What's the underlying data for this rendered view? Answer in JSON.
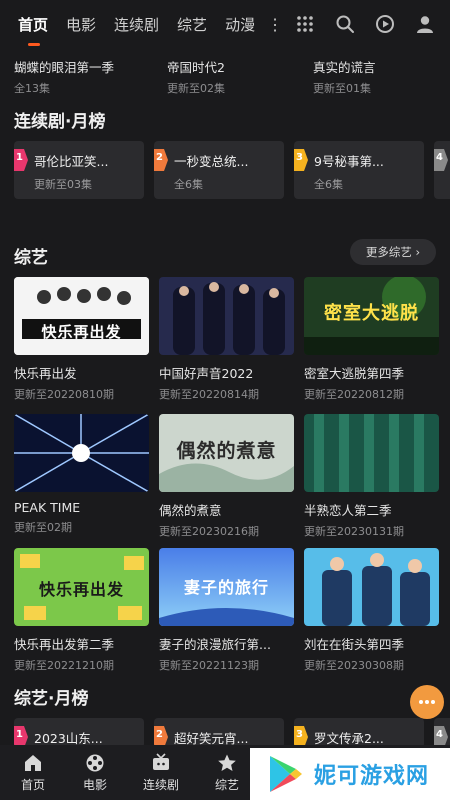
{
  "topnav": {
    "tabs": [
      {
        "label": "首页",
        "active": true
      },
      {
        "label": "电影",
        "active": false
      },
      {
        "label": "连续剧",
        "active": false
      },
      {
        "label": "综艺",
        "active": false
      },
      {
        "label": "动漫",
        "active": false
      }
    ],
    "more_glyph": "⋮",
    "icons": [
      "grid-icon",
      "search-icon",
      "play-history-icon",
      "user-icon"
    ]
  },
  "top_items": [
    {
      "title": "蝴蝶的眼泪第一季",
      "sub": "全13集"
    },
    {
      "title": "帝国时代2",
      "sub": "更新至02集"
    },
    {
      "title": "真实的谎言",
      "sub": "更新至01集"
    }
  ],
  "drama_rank": {
    "title": "连续剧·月榜",
    "items": [
      {
        "rank": "1",
        "title": "哥伦比亚笑...",
        "sub": "更新至03集",
        "color": "#e8376d"
      },
      {
        "rank": "2",
        "title": "一秒变总统...",
        "sub": "全6集",
        "color": "#f07a3c"
      },
      {
        "rank": "3",
        "title": "9号秘事第...",
        "sub": "全6集",
        "color": "#f5b21f"
      }
    ],
    "stub_rank": "4"
  },
  "variety": {
    "title": "综艺",
    "more_label": "更多综艺 ›",
    "rows": [
      [
        {
          "title": "快乐再出发",
          "sub": "更新至20220810期",
          "poster_text": "快乐再出发",
          "poster_bg": "#f2f2f2",
          "poster_fg": "#1a1a1a"
        },
        {
          "title": "中国好声音2022",
          "sub": "更新至20220814期",
          "poster_text": "",
          "poster_bg": "#2b2c52",
          "poster_fg": "#ffffff"
        },
        {
          "title": "密室大逃脱第四季",
          "sub": "更新至20220812期",
          "poster_text": "密室大逃脱",
          "poster_bg": "#234a2a",
          "poster_fg": "#ffe24a"
        }
      ],
      [
        {
          "title": "PEAK TIME",
          "sub": "更新至02期",
          "poster_text": "",
          "poster_bg": "#0d1a3a",
          "poster_fg": "#ffffff"
        },
        {
          "title": "偶然的煮意",
          "sub": "更新至20230216期",
          "poster_text": "偶然的煮意",
          "poster_bg": "#cdd7cf",
          "poster_fg": "#2b2b2b"
        },
        {
          "title": "半熟恋人第二季",
          "sub": "更新至20230131期",
          "poster_text": "",
          "poster_bg": "#1d5a4a",
          "poster_fg": "#ffffff"
        }
      ],
      [
        {
          "title": "快乐再出发第二季",
          "sub": "更新至20221210期",
          "poster_text": "快乐再出发",
          "poster_bg": "#6fc13a",
          "poster_fg": "#1a1a1a"
        },
        {
          "title": "妻子的浪漫旅行第...",
          "sub": "更新至20221123期",
          "poster_text": "妻子的旅行",
          "poster_bg": "#3e6fd8",
          "poster_fg": "#ffffff"
        },
        {
          "title": "刘在在街头第四季",
          "sub": "更新至20230308期",
          "poster_text": "",
          "poster_bg": "#4fb6e6",
          "poster_fg": "#ffffff"
        }
      ]
    ]
  },
  "variety_rank": {
    "title": "综艺·月榜",
    "items": [
      {
        "rank": "1",
        "title": "2023山东...",
        "color": "#e8376d"
      },
      {
        "rank": "2",
        "title": "超好笑元宵...",
        "color": "#f07a3c"
      },
      {
        "rank": "3",
        "title": "罗文传承2...",
        "color": "#f5b21f"
      }
    ],
    "stub_rank": "4"
  },
  "bottom_nav": [
    {
      "label": "首页",
      "icon": "home-icon"
    },
    {
      "label": "电影",
      "icon": "film-reel-icon"
    },
    {
      "label": "连续剧",
      "icon": "tv-icon"
    },
    {
      "label": "综艺",
      "icon": "star-icon"
    }
  ],
  "watermark": {
    "text": "妮可游戏网"
  }
}
